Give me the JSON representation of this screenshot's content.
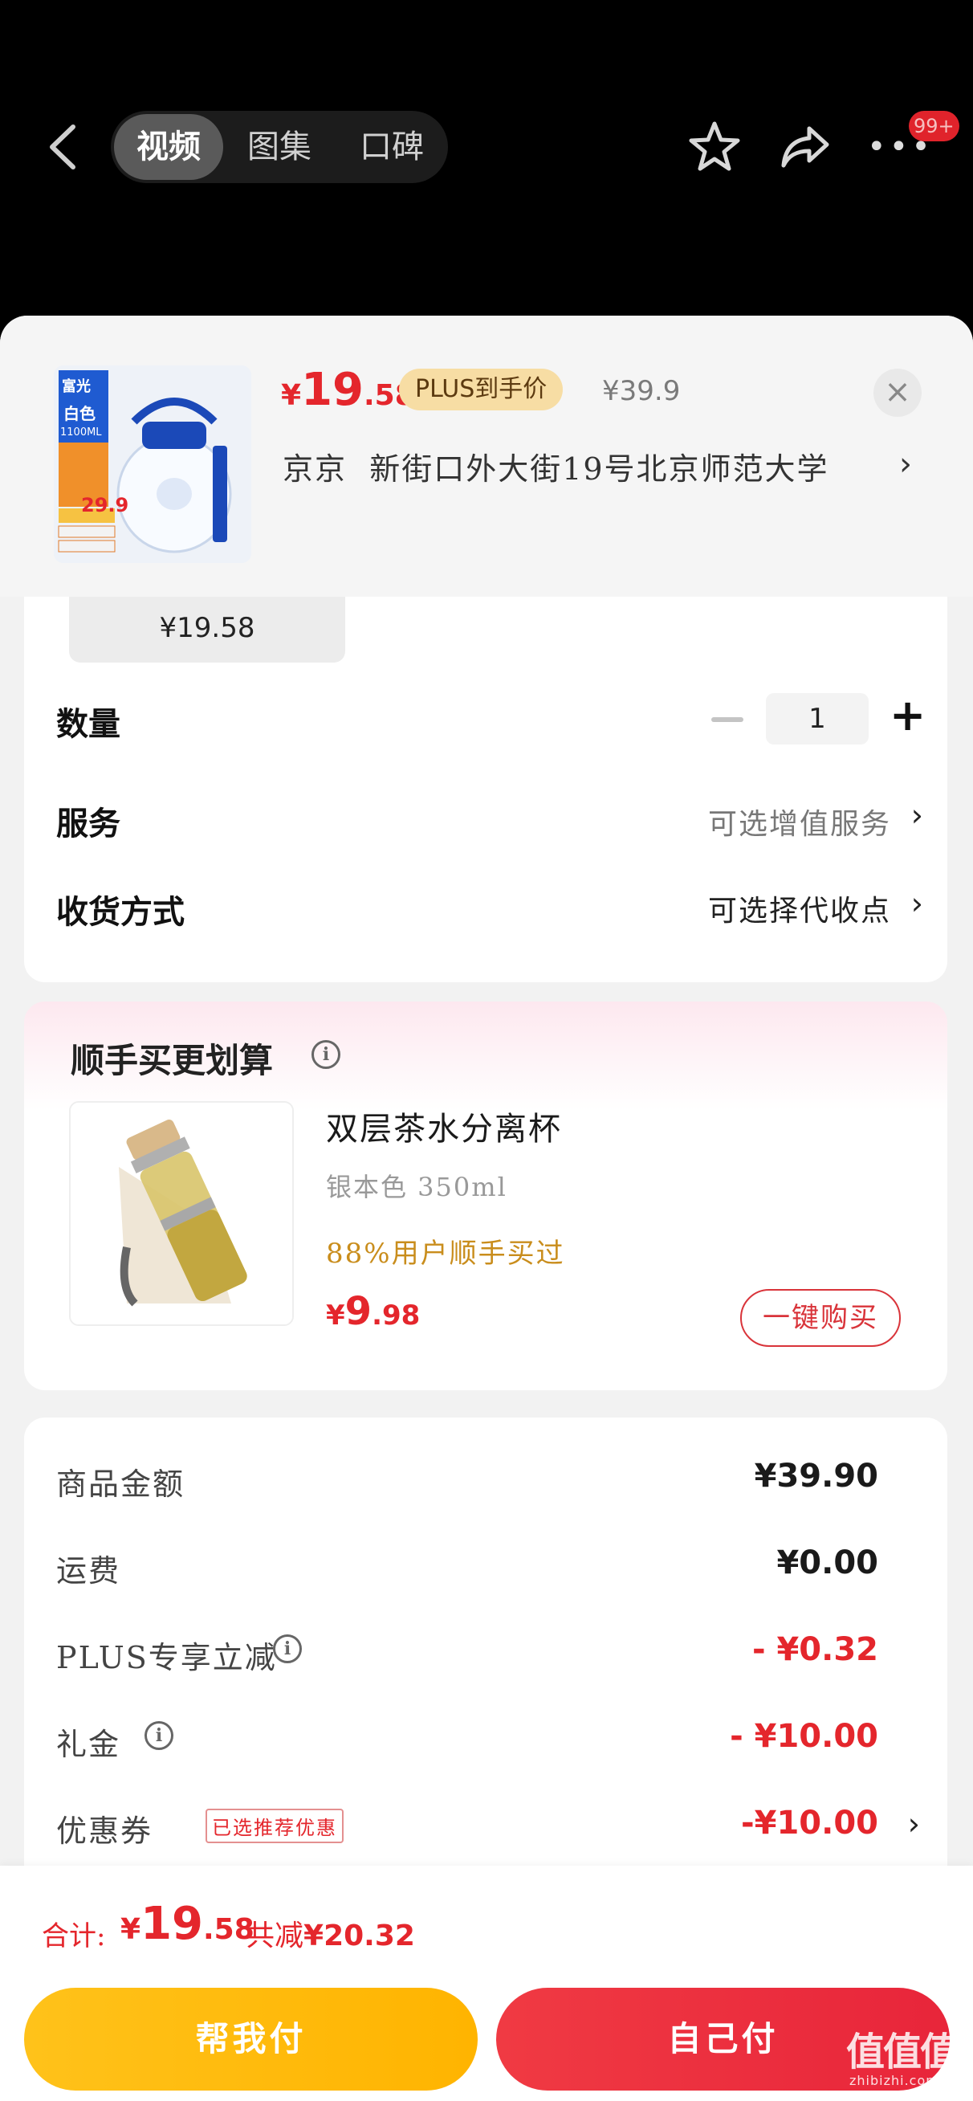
{
  "nav": {
    "tabs": [
      "视频",
      "图集",
      "口碑"
    ],
    "badge": "99+"
  },
  "product": {
    "price_currency": "¥",
    "price_int": "19",
    "price_dec": ".58",
    "plus_tag": "PLUS到手价",
    "original_price": "¥39.9",
    "address_name": "京京",
    "address": "新街口外大街19号北京师范大学",
    "thumb_text": {
      "brand": "富光",
      "color": "白色",
      "volume": "1100ML",
      "promo_price": "29.9"
    }
  },
  "spec": {
    "chip_price": "¥19.58",
    "quantity_label": "数量",
    "quantity_value": "1",
    "service_label": "服务",
    "service_value": "可选增值服务",
    "delivery_label": "收货方式",
    "delivery_value": "可选择代收点"
  },
  "bundle": {
    "title": "顺手买更划算",
    "item_name": "双层茶水分离杯",
    "variant": "银本色 350ml",
    "social_proof": "88%用户顺手买过",
    "price_currency": "¥",
    "price_int": "9",
    "price_dec": ".98",
    "buy_label": "一键购买"
  },
  "summary": {
    "rows": [
      {
        "label": "商品金额",
        "value": "¥39.90"
      },
      {
        "label": "运费",
        "value": "¥0.00"
      },
      {
        "label": "PLUS专享立减",
        "value": "- ¥0.32"
      },
      {
        "label": "礼金",
        "value": "- ¥10.00"
      },
      {
        "label": "优惠券",
        "value": "-¥10.00"
      }
    ],
    "coupon_tag": "已选推荐优惠"
  },
  "checkout": {
    "total_label": "合计:",
    "total_currency": "¥",
    "total_int": "19",
    "total_dec": ".58",
    "save_prefix": "共减",
    "save_amount": "¥20.32",
    "help_pay_label": "帮我付",
    "self_pay_label": "自己付"
  },
  "watermark": {
    "text": "值值值",
    "sub": "zhibizhi.com"
  },
  "colors": {
    "accent_red": "#e4262c",
    "plus_gold": "#f7dda4",
    "help_button": "#ffb400",
    "self_button": "#e8253a"
  }
}
